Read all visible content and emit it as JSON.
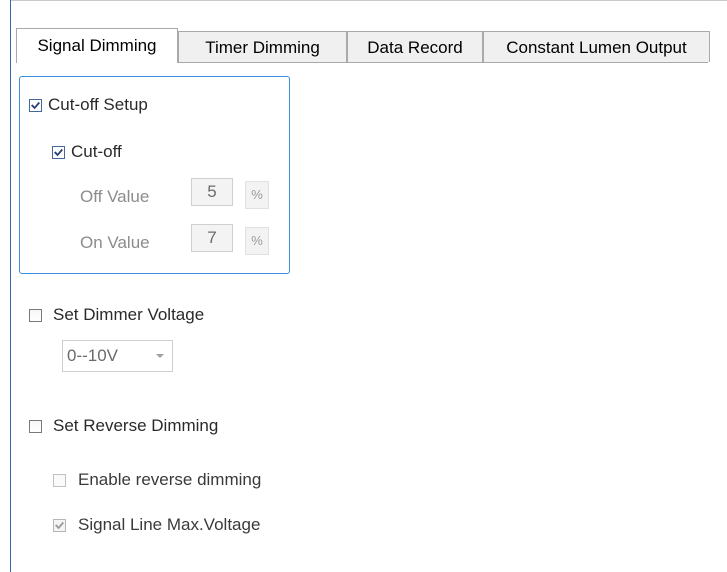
{
  "tabs": [
    {
      "label": "Signal Dimming",
      "active": true
    },
    {
      "label": "Timer Dimming",
      "active": false
    },
    {
      "label": "Data Record",
      "active": false
    },
    {
      "label": "Constant Lumen Output",
      "active": false
    }
  ],
  "cutoff_setup": {
    "label": "Cut-off Setup",
    "checked": true,
    "cutoff": {
      "label": "Cut-off",
      "checked": true
    },
    "off_value": {
      "label": "Off Value",
      "value": "5",
      "unit": "%"
    },
    "on_value": {
      "label": "On Value",
      "value": "7",
      "unit": "%"
    }
  },
  "dimmer_voltage": {
    "label": "Set Dimmer Voltage",
    "checked": false,
    "selected": "0--10V"
  },
  "reverse_dimming": {
    "label": "Set Reverse Dimming",
    "checked": false,
    "enable_label": "Enable reverse dimming",
    "enable_checked": false,
    "signal_line_label": "Signal Line Max.Voltage",
    "signal_line_checked": true
  }
}
